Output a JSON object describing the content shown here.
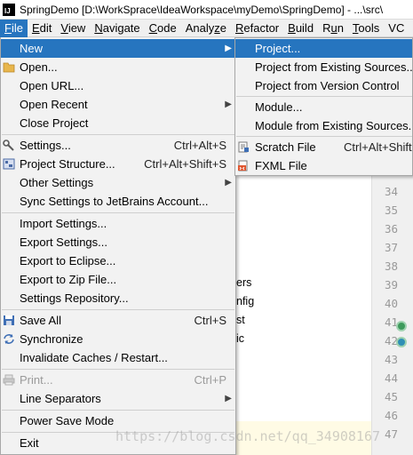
{
  "window": {
    "title": "SpringDemo [D:\\WorkSprace\\IdeaWorkspace\\myDemo\\SpringDemo] - ...\\src\\"
  },
  "menubar": {
    "items": [
      "File",
      "Edit",
      "View",
      "Navigate",
      "Code",
      "Analyze",
      "Refactor",
      "Build",
      "Run",
      "Tools",
      "VC"
    ],
    "active": "File"
  },
  "file_menu": {
    "items": [
      {
        "label": "New",
        "shortcut": "",
        "submenu": true,
        "highlighted": true
      },
      {
        "label": "Open...",
        "shortcut": "",
        "icon": "folder-icon"
      },
      {
        "label": "Open URL...",
        "shortcut": ""
      },
      {
        "label": "Open Recent",
        "shortcut": "",
        "submenu": true
      },
      {
        "label": "Close Project",
        "shortcut": ""
      },
      {
        "label": "Settings...",
        "shortcut": "Ctrl+Alt+S",
        "icon": "wrench-icon"
      },
      {
        "label": "Project Structure...",
        "shortcut": "Ctrl+Alt+Shift+S",
        "icon": "project-structure-icon"
      },
      {
        "label": "Other Settings",
        "shortcut": "",
        "submenu": true
      },
      {
        "label": "Sync Settings to JetBrains Account...",
        "shortcut": ""
      },
      {
        "label": "Import Settings...",
        "shortcut": ""
      },
      {
        "label": "Export Settings...",
        "shortcut": ""
      },
      {
        "label": "Export to Eclipse...",
        "shortcut": ""
      },
      {
        "label": "Export to Zip File...",
        "shortcut": ""
      },
      {
        "label": "Settings Repository...",
        "shortcut": ""
      },
      {
        "label": "Save All",
        "shortcut": "Ctrl+S",
        "icon": "save-icon"
      },
      {
        "label": "Synchronize",
        "shortcut": "",
        "icon": "sync-icon"
      },
      {
        "label": "Invalidate Caches / Restart...",
        "shortcut": ""
      },
      {
        "label": "Print...",
        "shortcut": "Ctrl+P",
        "icon": "print-icon",
        "disabled": true
      },
      {
        "label": "Line Separators",
        "shortcut": "",
        "submenu": true
      },
      {
        "label": "Power Save Mode",
        "shortcut": ""
      },
      {
        "label": "Exit",
        "shortcut": ""
      }
    ]
  },
  "new_submenu": {
    "items": [
      {
        "label": "Project...",
        "shortcut": "",
        "highlighted": true
      },
      {
        "label": "Project from Existing Sources...",
        "shortcut": ""
      },
      {
        "label": "Project from Version Control",
        "shortcut": "",
        "submenu": true
      },
      {
        "label": "Module...",
        "shortcut": ""
      },
      {
        "label": "Module from Existing Sources...",
        "shortcut": ""
      },
      {
        "label": "Scratch File",
        "shortcut": "Ctrl+Alt+Shift",
        "icon": "scratch-file-icon"
      },
      {
        "label": "FXML File",
        "shortcut": "",
        "icon": "fxml-file-icon"
      }
    ]
  },
  "editor": {
    "line_numbers": [
      "34",
      "35",
      "36",
      "37",
      "38",
      "39",
      "40",
      "41",
      "42",
      "43",
      "44",
      "45",
      "46",
      "47"
    ],
    "fragments": [
      "ers",
      "nfig",
      "st",
      "ic"
    ]
  },
  "colors": {
    "highlight": "#2675bf",
    "menu_bg": "#f2f2f2"
  },
  "watermark": "https://blog.csdn.net/qq_34908167"
}
